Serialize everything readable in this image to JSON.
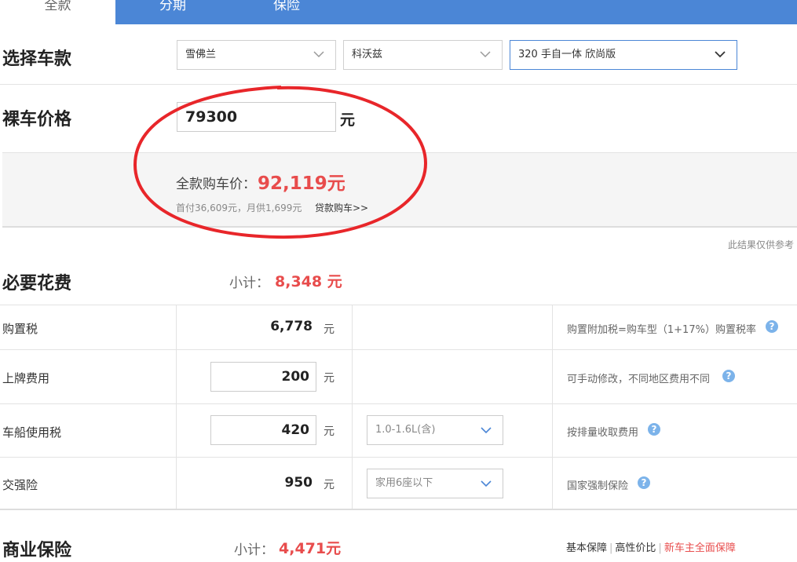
{
  "tabs": [
    {
      "label": "全款",
      "active": true
    },
    {
      "label": "分期",
      "active": false
    },
    {
      "label": "保险",
      "active": false
    }
  ],
  "select_car": {
    "title": "选择车款",
    "brand": "雪佛兰",
    "series": "科沃兹",
    "model": "320 手自一体 欣尚版"
  },
  "bare_price": {
    "title": "裸车价格",
    "value": "79300",
    "unit": "元"
  },
  "summary": {
    "label": "全款购车价：",
    "value": "92,119元",
    "detail": "首付36,609元，月供1,699元",
    "loan_link": "贷款购车>>"
  },
  "note": "此结果仅供参考",
  "required": {
    "title": "必要花费",
    "subtotal_label": "小计：",
    "subtotal_value": "8,348 元",
    "rows": [
      {
        "label": "购置税",
        "value": "6,778",
        "unit": "元",
        "note": "购置附加税=购车型（1+17%）购置税率"
      },
      {
        "label": "上牌费用",
        "value": "200",
        "unit": "元",
        "note": "可手动修改，不同地区费用不同"
      },
      {
        "label": "车船使用税",
        "value": "420",
        "unit": "元",
        "option": "1.0-1.6L(含)",
        "note": "按排量收取费用"
      },
      {
        "label": "交强险",
        "value": "950",
        "unit": "元",
        "option": "家用6座以下",
        "note": "国家强制保险"
      }
    ]
  },
  "commercial": {
    "title": "商业保险",
    "subtotal_label": "小计：",
    "subtotal_value": "4,471元",
    "links": [
      "基本保障",
      "高性价比",
      "新车主全面保障"
    ]
  },
  "colors": {
    "tab_bar": "#4b86d6",
    "accent_red": "#e84c4c",
    "help_icon": "#7cb3ea"
  }
}
